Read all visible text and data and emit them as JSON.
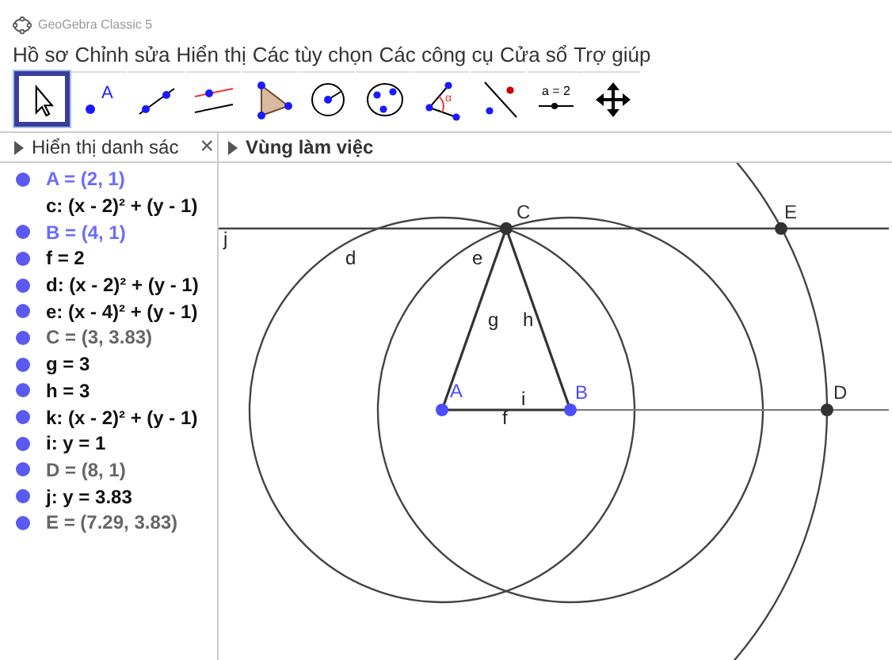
{
  "window": {
    "title": "GeoGebra Classic 5"
  },
  "menu": [
    "Hồ sơ",
    "Chỉnh sửa",
    "Hiển thị",
    "Các tùy chọn",
    "Các công cụ",
    "Cửa sổ",
    "Trợ giúp"
  ],
  "toolbar": [
    {
      "kind": "move",
      "selected": true
    },
    {
      "kind": "point",
      "selected": false,
      "text": "A"
    },
    {
      "kind": "line",
      "selected": false
    },
    {
      "kind": "parallel",
      "selected": false
    },
    {
      "kind": "polygon",
      "selected": false
    },
    {
      "kind": "circle",
      "selected": false
    },
    {
      "kind": "conic",
      "selected": false
    },
    {
      "kind": "angle",
      "selected": false,
      "text": "α"
    },
    {
      "kind": "reflect",
      "selected": false
    },
    {
      "kind": "slider",
      "selected": false,
      "text": "a = 2"
    },
    {
      "kind": "pan",
      "selected": false
    }
  ],
  "algebra_panel": {
    "title": "Hiển thị danh sác",
    "close": "×",
    "items": [
      {
        "text": "A = (2, 1)",
        "kind": "free",
        "visible": true
      },
      {
        "text": "c: (x - 2)² + (y - 1)",
        "kind": "object",
        "visible": false
      },
      {
        "text": "B = (4, 1)",
        "kind": "free",
        "visible": true
      },
      {
        "text": "f = 2",
        "kind": "object",
        "visible": true
      },
      {
        "text": "d: (x - 2)² + (y - 1)",
        "kind": "object",
        "visible": true
      },
      {
        "text": "e: (x - 4)² + (y - 1)",
        "kind": "object",
        "visible": true
      },
      {
        "text": "C = (3, 3.83)",
        "kind": "dependent",
        "visible": true
      },
      {
        "text": "g = 3",
        "kind": "object",
        "visible": true
      },
      {
        "text": "h = 3",
        "kind": "object",
        "visible": true
      },
      {
        "text": "k: (x - 2)² + (y - 1)",
        "kind": "object",
        "visible": true
      },
      {
        "text": "i: y = 1",
        "kind": "object",
        "visible": true
      },
      {
        "text": "D = (8, 1)",
        "kind": "dependent",
        "visible": true
      },
      {
        "text": "j: y = 3.83",
        "kind": "object",
        "visible": true
      },
      {
        "text": "E = (7.29, 3.83)",
        "kind": "dependent",
        "visible": true
      }
    ]
  },
  "graphics_panel": {
    "title": "Vùng làm việc",
    "objects": [
      {
        "label": "j",
        "kind": "line"
      },
      {
        "label": "d",
        "kind": "circle"
      },
      {
        "label": "e",
        "kind": "circle"
      },
      {
        "label": "g",
        "kind": "segment"
      },
      {
        "label": "h",
        "kind": "segment"
      },
      {
        "label": "i",
        "kind": "line"
      },
      {
        "label": "f",
        "kind": "segment"
      },
      {
        "kind": "circle"
      }
    ],
    "points": [
      {
        "label": "C",
        "color": "#333333"
      },
      {
        "label": "E",
        "color": "#333333"
      },
      {
        "label": "A",
        "color": "#4d4dff"
      },
      {
        "label": "B",
        "color": "#4d4dff"
      },
      {
        "label": "D",
        "color": "#333333"
      }
    ]
  }
}
